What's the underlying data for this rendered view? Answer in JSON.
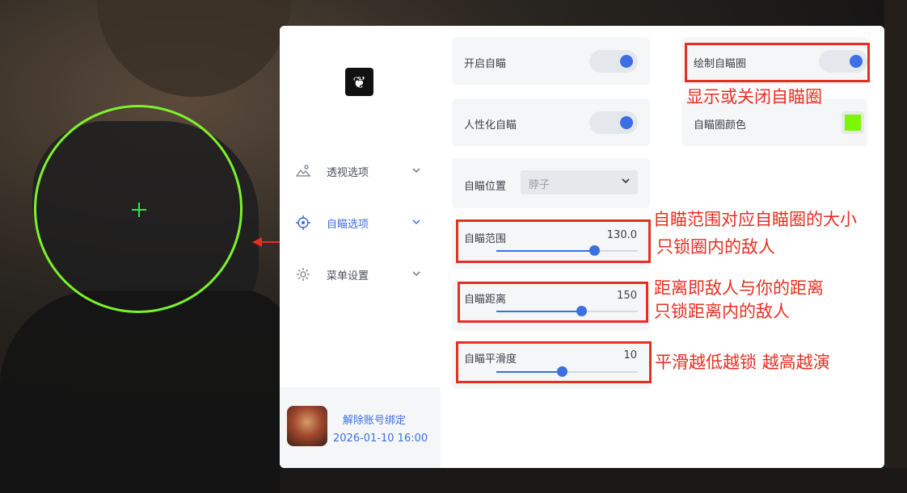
{
  "sidebar": {
    "nav": [
      {
        "label": "透视选项",
        "icon": "landscape-icon"
      },
      {
        "label": "自瞄选项",
        "icon": "crosshair-icon"
      },
      {
        "label": "菜单设置",
        "icon": "gear-icon"
      }
    ],
    "user": {
      "unbind_label": "解除账号绑定",
      "expire": "2026-01-10 16:00"
    }
  },
  "settings": {
    "enable_aim": {
      "label": "开启自瞄",
      "on": true
    },
    "draw_aim_circle": {
      "label": "绘制自瞄圈",
      "on": true
    },
    "humanized_aim": {
      "label": "人性化自瞄",
      "on": true
    },
    "aim_circle_color": {
      "label": "自瞄圈颜色",
      "color": "#7cf700"
    },
    "aim_position": {
      "label": "自瞄位置",
      "value": "脖子"
    },
    "aim_range": {
      "label": "自瞄范围",
      "value": "130.0",
      "fraction": 0.69
    },
    "aim_distance": {
      "label": "自瞄距离",
      "value": "150",
      "fraction": 0.6
    },
    "aim_smooth": {
      "label": "自瞄平滑度",
      "value": "10",
      "fraction": 0.46
    }
  },
  "annotations": {
    "circle_note": "显示或关闭自瞄圈",
    "range_note_1": "自瞄范围对应自瞄圈的大小",
    "range_note_2": "只锁圈内的敌人",
    "distance_note_1": "距离即敌人与你的距离",
    "distance_note_2": "只锁距离内的敌人",
    "smooth_note": "平滑越低越锁 越高越演"
  },
  "colors": {
    "accent": "#3b6fe3",
    "annotation": "#e52f22",
    "aim_circle": "#7cf22a"
  }
}
